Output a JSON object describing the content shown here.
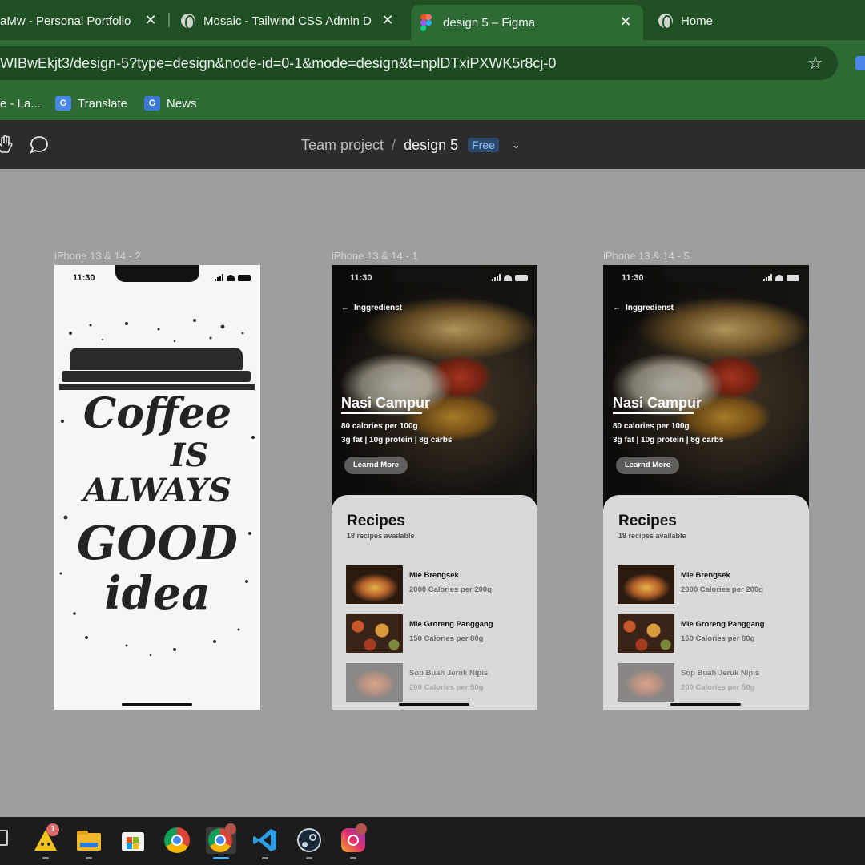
{
  "browser": {
    "tabs": [
      {
        "title": "aMw - Personal Portfolio",
        "close": "✕"
      },
      {
        "title": "Mosaic - Tailwind CSS Admin Da",
        "close": "✕",
        "icon": "globe-icon"
      },
      {
        "title": "design 5 – Figma",
        "close": "✕",
        "icon": "figma-icon",
        "active": true
      },
      {
        "title": "Home",
        "icon": "globe-icon"
      }
    ],
    "url": "WIBwEkjt3/design-5?type=design&node-id=0-1&mode=design&t=nplDTxiPXWK5r8cj-0",
    "star": "☆",
    "bookmarks": [
      {
        "label": "e - La..."
      },
      {
        "label": "Translate",
        "icon": "google-translate-icon"
      },
      {
        "label": "News",
        "icon": "google-news-icon"
      }
    ]
  },
  "figma": {
    "breadcrumb": {
      "project": "Team project",
      "separator": "/",
      "file": "design 5",
      "plan_badge": "Free",
      "chevron": "⌄"
    }
  },
  "canvas": {
    "frames": [
      {
        "label": "iPhone 13 & 14 - 2",
        "time": "11:30",
        "poster": {
          "line1": "Coffee",
          "line2": "IS",
          "line3": "ALWAYS",
          "line4": "GOOD",
          "line5": "idea"
        }
      },
      {
        "label": "iPhone 13 & 14 - 1",
        "time": "11:30",
        "back_label": "Inggredienst",
        "dish": {
          "name": "Nasi Campur",
          "calories": "80 calories per 100g",
          "macros": "3g fat | 10g protein | 8g carbs",
          "button": "Learnd More"
        },
        "recipes_title": "Recipes",
        "recipes_count": "18 recipes available",
        "recipes": [
          {
            "name": "Mie Brengsek",
            "calories": "2000 Calories per 200g"
          },
          {
            "name": "Mie Groreng Panggang",
            "calories": "150 Calories per 80g"
          },
          {
            "name": "Sop Buah Jeruk Nipis",
            "calories": "200 Calories per 50g"
          }
        ]
      },
      {
        "label": "iPhone 13 & 14 - 5",
        "time": "11:30",
        "back_label": "Inggredienst",
        "dish": {
          "name": "Nasi Campur",
          "calories": "80 calories per 100g",
          "macros": "3g fat | 10g protein | 8g carbs",
          "button": "Learnd More"
        },
        "recipes_title": "Recipes",
        "recipes_count": "18 recipes available",
        "recipes": [
          {
            "name": "Mie Brengsek",
            "calories": "2000 Calories per 200g"
          },
          {
            "name": "Mie Groreng Panggang",
            "calories": "150 Calories per 80g"
          },
          {
            "name": "Sop Buah Jeruk Nipis",
            "calories": "200 Calories per 50g"
          }
        ]
      }
    ]
  },
  "taskbar": {
    "apps": [
      {
        "icon": "task-view-icon"
      },
      {
        "icon": "warning-app-icon",
        "badge": "1"
      },
      {
        "icon": "file-explorer-icon"
      },
      {
        "icon": "microsoft-store-icon"
      },
      {
        "icon": "chrome-icon"
      },
      {
        "icon": "chrome-profile-icon",
        "active": true
      },
      {
        "icon": "vscode-icon"
      },
      {
        "icon": "steam-icon"
      },
      {
        "icon": "instagram-icon"
      }
    ]
  },
  "colors": {
    "tab_bar": "#1f4f23",
    "toolbar": "#2e6a33",
    "figma_toolbar": "#2c2c2c",
    "canvas": "#9e9e9e",
    "sheet": "#d9d9d9",
    "badge_text": "#8fc1ff"
  }
}
